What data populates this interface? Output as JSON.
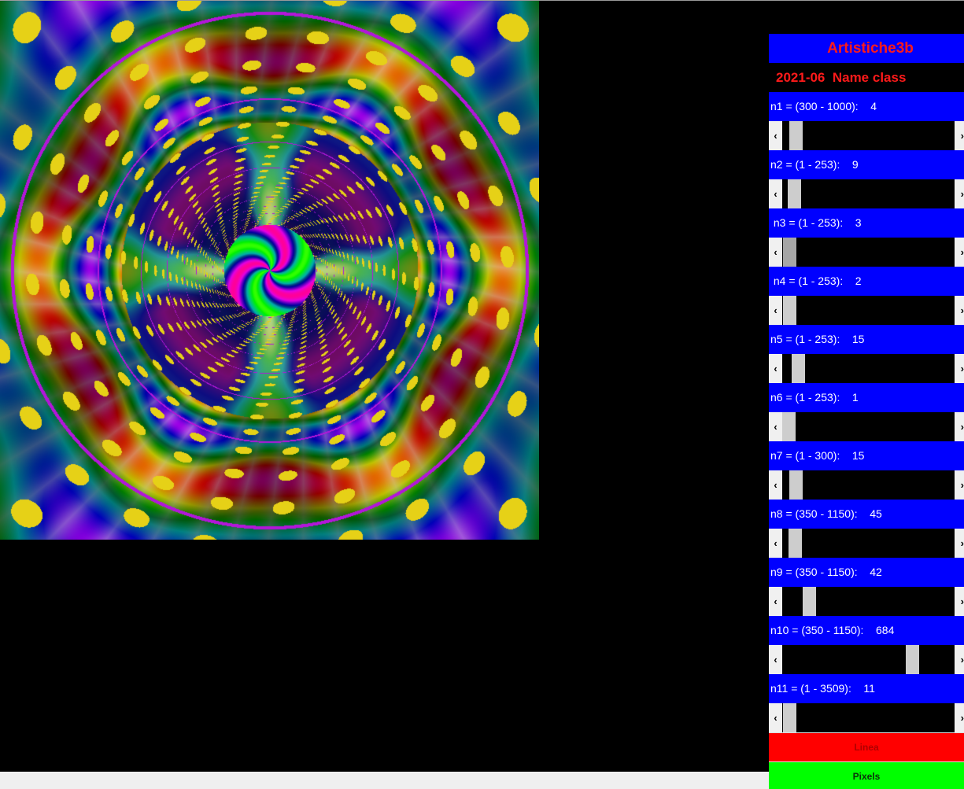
{
  "window": {
    "title": "Artistiche3b",
    "subtitle": "2021-06  Name class"
  },
  "params": [
    {
      "label": "n1 = (300 - 1000):    4",
      "min": 300,
      "max": 1000,
      "value": 4
    },
    {
      "label": "n2 = (1 - 253):    9",
      "min": 1,
      "max": 253,
      "value": 9
    },
    {
      "label": " n3 = (1 - 253):    3",
      "min": 1,
      "max": 253,
      "value": 3
    },
    {
      "label": " n4 = (1 - 253):    2",
      "min": 1,
      "max": 253,
      "value": 2
    },
    {
      "label": "n5 = (1 - 253):    15",
      "min": 1,
      "max": 253,
      "value": 15
    },
    {
      "label": "n6 = (1 - 253):    1",
      "min": 1,
      "max": 253,
      "value": 1
    },
    {
      "label": "n7 = (1 - 300):    15",
      "min": 1,
      "max": 300,
      "value": 15
    },
    {
      "label": "n8 = (350 - 1150):    45",
      "min": 350,
      "max": 1150,
      "value": 45
    },
    {
      "label": "n9 = (350 - 1150):    42",
      "min": 350,
      "max": 1150,
      "value": 42
    },
    {
      "label": "n10 = (350 - 1150):    684",
      "min": 350,
      "max": 1150,
      "value": 684
    },
    {
      "label": "n11 = (1 - 3509):    11",
      "min": 1,
      "max": 3509,
      "value": 11
    }
  ],
  "scrollbar_positions": [
    0.045,
    0.036,
    0.005,
    0.005,
    0.057,
    0.0,
    0.047,
    0.041,
    0.131,
    0.776,
    0.003
  ],
  "active_scrollbar": 2,
  "buttons": {
    "linea": "Linea",
    "pixels": "Pixels"
  },
  "icons": {
    "left_arrow": "‹",
    "right_arrow": "›"
  },
  "colors": {
    "panel_blue": "#0000ff",
    "title_red": "#ff1a1a",
    "linea_red": "#ff0000",
    "pixels_green": "#00ff00"
  }
}
